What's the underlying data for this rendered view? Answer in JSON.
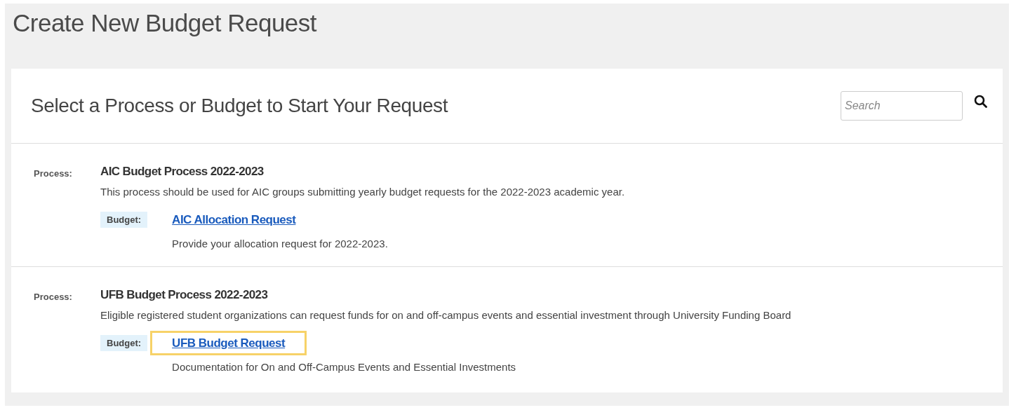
{
  "page": {
    "title": "Create New Budget Request"
  },
  "card": {
    "heading": "Select a Process or Budget to Start Your Request",
    "search": {
      "placeholder": "Search"
    }
  },
  "processes": [
    {
      "label": "Process:",
      "title": "AIC Budget Process 2022-2023",
      "description": "This process should be used for AIC groups submitting yearly budget requests for the 2022-2023 academic year.",
      "budgets": [
        {
          "label": "Budget:",
          "link": "AIC Allocation Request",
          "description": "Provide your allocation request for 2022-2023.",
          "highlighted": false
        }
      ]
    },
    {
      "label": "Process:",
      "title": "UFB Budget Process 2022-2023",
      "description": "Eligible registered student organizations can request funds for on and off-campus events and essential investment through University Funding Board",
      "budgets": [
        {
          "label": "Budget:",
          "link": "UFB Budget Request",
          "description": "Documentation for On and Off-Campus Events and Essential Investments",
          "highlighted": true
        }
      ]
    }
  ]
}
